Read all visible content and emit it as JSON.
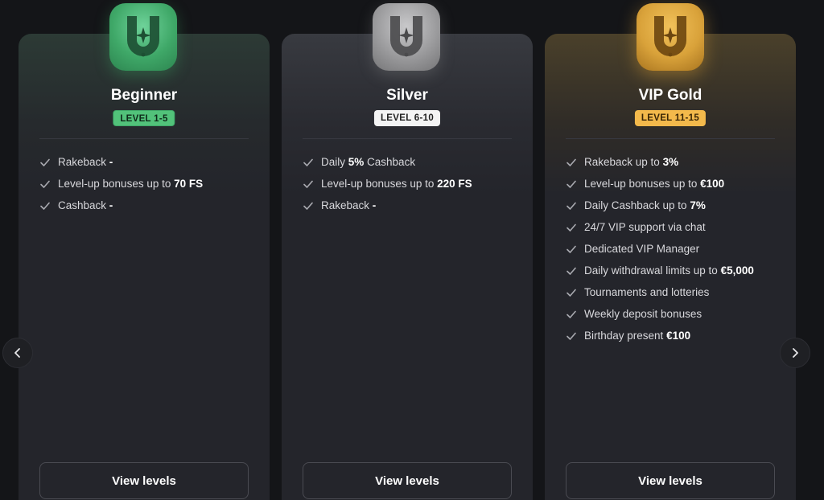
{
  "tiers": [
    {
      "name": "Beginner",
      "badge": "LEVEL 1-5",
      "features": [
        {
          "pre": "Rakeback ",
          "bold": "-",
          "post": ""
        },
        {
          "pre": "Level-up bonuses up to ",
          "bold": "70 FS",
          "post": ""
        },
        {
          "pre": "Cashback ",
          "bold": "-",
          "post": ""
        }
      ],
      "button": "View levels",
      "color": "#52c27a"
    },
    {
      "name": "Silver",
      "badge": "LEVEL 6-10",
      "features": [
        {
          "pre": "Daily ",
          "bold": "5%",
          "post": " Cashback"
        },
        {
          "pre": "Level-up bonuses up to ",
          "bold": "220 FS",
          "post": ""
        },
        {
          "pre": "Rakeback ",
          "bold": "-",
          "post": ""
        }
      ],
      "button": "View levels",
      "color": "#f4f4f4"
    },
    {
      "name": "VIP Gold",
      "badge": "LEVEL 11-15",
      "features": [
        {
          "pre": "Rakeback up to ",
          "bold": "3%",
          "post": ""
        },
        {
          "pre": "Level-up bonuses up to ",
          "bold": "€100",
          "post": ""
        },
        {
          "pre": "Daily Cashback up to ",
          "bold": "7%",
          "post": ""
        },
        {
          "pre": "24/7 VIP support via chat",
          "bold": "",
          "post": ""
        },
        {
          "pre": "Dedicated VIP Manager",
          "bold": "",
          "post": ""
        },
        {
          "pre": "Daily withdrawal limits up to ",
          "bold": "€5,000",
          "post": ""
        },
        {
          "pre": "Tournaments and lotteries",
          "bold": "",
          "post": ""
        },
        {
          "pre": "Weekly deposit bonuses",
          "bold": "",
          "post": ""
        },
        {
          "pre": "Birthday present ",
          "bold": "€100",
          "post": ""
        }
      ],
      "button": "View levels",
      "color": "#f3b94b"
    }
  ],
  "icons": {
    "emblem": "horseshoe-star-icon",
    "check": "check-icon",
    "prev": "chevron-left-icon",
    "next": "chevron-right-icon"
  }
}
